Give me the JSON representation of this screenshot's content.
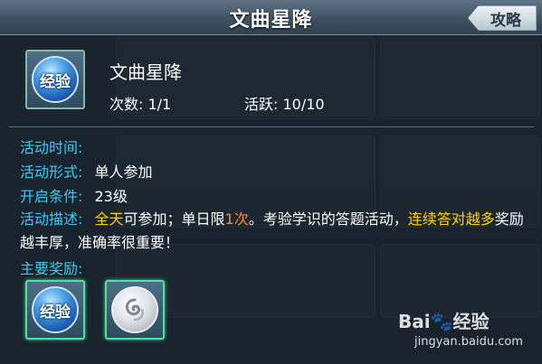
{
  "dialog": {
    "title": "文曲星降",
    "guide_button": "攻略"
  },
  "activity": {
    "icon_label": "经验",
    "name": "文曲星降",
    "times": "次数: 1/1",
    "activity_points": "活跃: 10/10"
  },
  "details": {
    "time_label": "活动时间:",
    "time_value": "",
    "form_label": "活动形式:",
    "form_value": "单人参加",
    "condition_label": "开启条件:",
    "condition_value": "23级",
    "desc_label": "活动描述:",
    "desc_parts": {
      "p1": "全天",
      "p2": "可参加；单日限",
      "p3": "1次",
      "p4": "。考验学识的答题活动，",
      "p5": "连续答对越多",
      "p6": "奖励越丰厚，准确率很重要！"
    },
    "rewards_label": "主要奖励:"
  },
  "rewards": [
    {
      "label": "经验",
      "icon": "exp-orb-icon"
    },
    {
      "label": "",
      "icon": "silver-swirl-icon"
    }
  ],
  "watermark": {
    "brand": "Bai🐾经验",
    "url": "jingyan.baidu.com"
  },
  "colors": {
    "label_cyan": "#3fc9f0",
    "highlight_yellow": "#ffd200",
    "highlight_orange": "#ff8a2a"
  }
}
